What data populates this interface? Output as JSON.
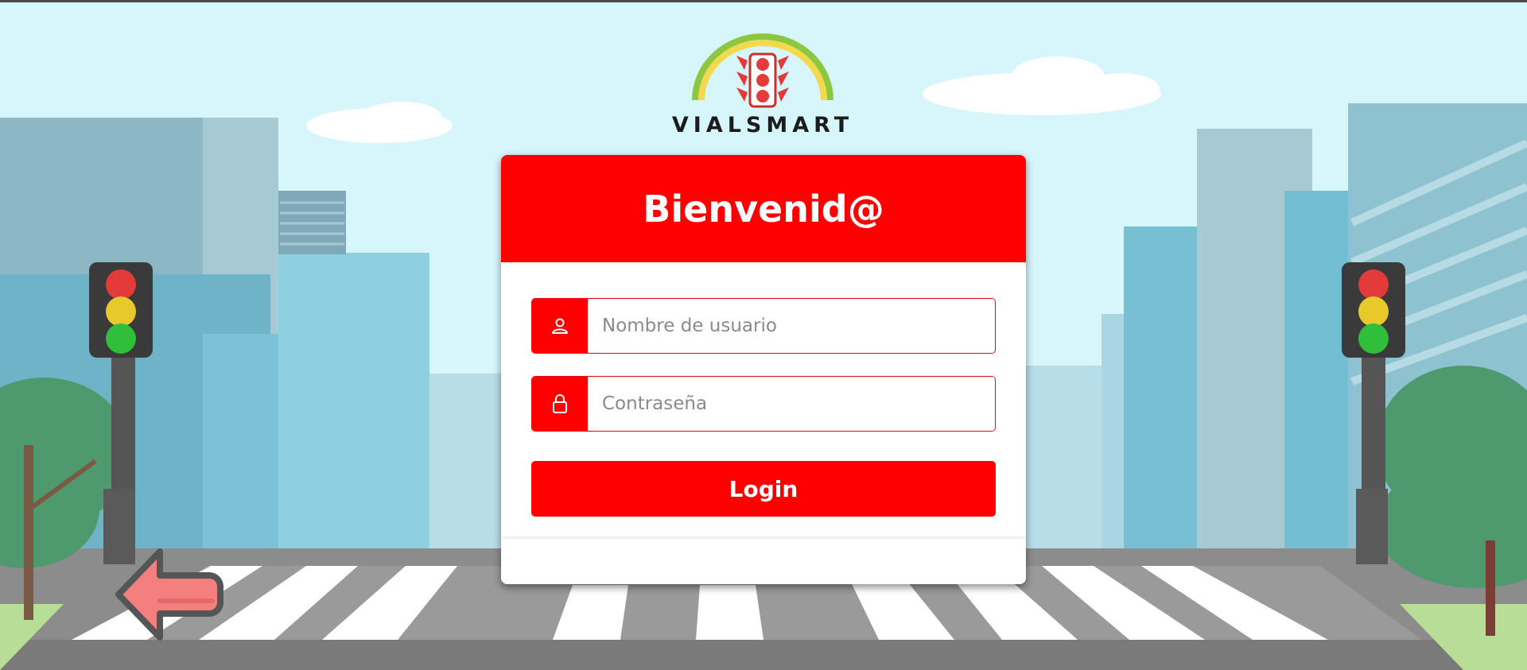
{
  "brand": {
    "name": "VIALSMART"
  },
  "login_card": {
    "title": "Bienvenid@",
    "username_placeholder": "Nombre de usuario",
    "password_placeholder": "Contraseña",
    "submit_label": "Login"
  },
  "icons": {
    "username": "user-icon",
    "password": "lock-icon",
    "back": "back-arrow-icon",
    "logo": "traffic-light-logo-icon"
  },
  "colors": {
    "accent": "#ff0000",
    "sky": "#d6f6fb",
    "back_arrow": "#f47f7f"
  }
}
